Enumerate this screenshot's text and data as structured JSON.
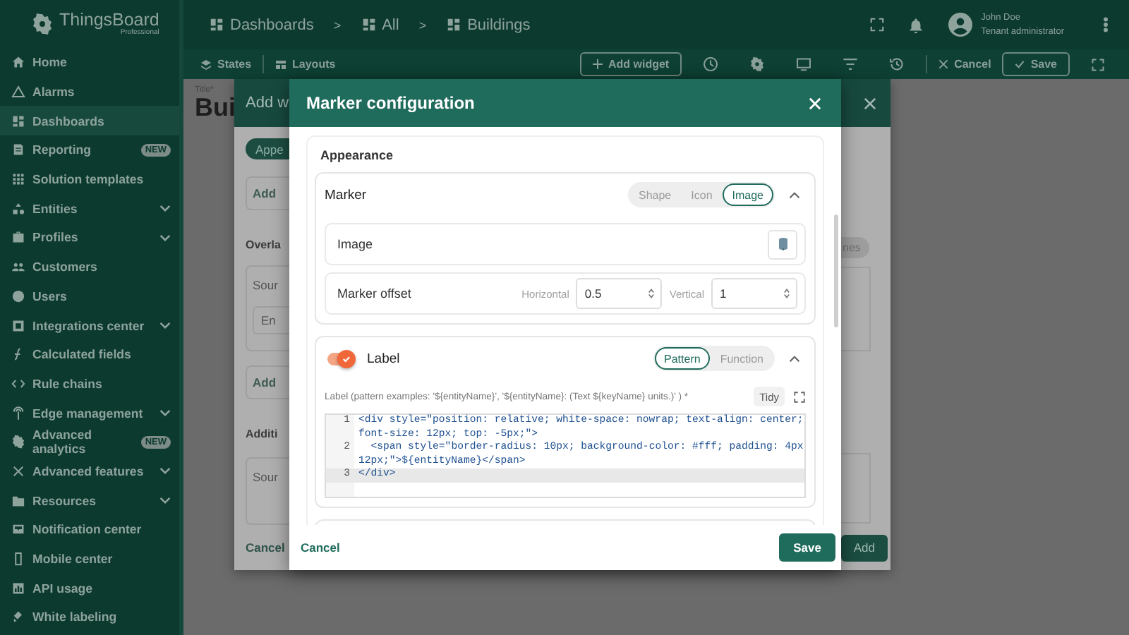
{
  "header": {
    "logo": {
      "name": "ThingsBoard",
      "edition": "Professional"
    },
    "breadcrumbs": [
      {
        "label": "Dashboards"
      },
      {
        "label": "All",
        "separator": ">"
      },
      {
        "label": "Buildings",
        "separator": ">"
      }
    ],
    "user": {
      "name": "John Doe",
      "role": "Tenant administrator"
    }
  },
  "sidebar": {
    "items": [
      {
        "label": "Home",
        "selected": false,
        "expandable": false
      },
      {
        "label": "Alarms",
        "selected": false,
        "expandable": false
      },
      {
        "label": "Dashboards",
        "selected": true,
        "expandable": false
      },
      {
        "label": "Reporting",
        "selected": false,
        "expandable": false,
        "badge": "NEW"
      },
      {
        "label": "Solution templates",
        "selected": false,
        "expandable": false
      },
      {
        "label": "Entities",
        "selected": false,
        "expandable": true
      },
      {
        "label": "Profiles",
        "selected": false,
        "expandable": true
      },
      {
        "label": "Customers",
        "selected": false,
        "expandable": false
      },
      {
        "label": "Users",
        "selected": false,
        "expandable": false
      },
      {
        "label": "Integrations center",
        "selected": false,
        "expandable": true
      },
      {
        "label": "Calculated fields",
        "selected": false,
        "expandable": false
      },
      {
        "label": "Rule chains",
        "selected": false,
        "expandable": false
      },
      {
        "label": "Edge management",
        "selected": false,
        "expandable": true
      },
      {
        "label": "Advanced analytics",
        "selected": false,
        "expandable": false,
        "badge": "NEW"
      },
      {
        "label": "Advanced features",
        "selected": false,
        "expandable": true
      },
      {
        "label": "Resources",
        "selected": false,
        "expandable": true
      },
      {
        "label": "Notification center",
        "selected": false,
        "expandable": false
      },
      {
        "label": "Mobile center",
        "selected": false,
        "expandable": false
      },
      {
        "label": "API usage",
        "selected": false,
        "expandable": false
      },
      {
        "label": "White labeling",
        "selected": false,
        "expandable": false
      }
    ]
  },
  "toolbar": {
    "states": "States",
    "layouts": "Layouts",
    "add_widget": "Add widget",
    "cancel": "Cancel",
    "save": "Save"
  },
  "content": {
    "title_label": "Title*",
    "title_value": "Bui"
  },
  "back_dialog": {
    "title": "Add w",
    "tab": "Appe",
    "add_1": "Add",
    "section_1": "Overla",
    "source_1": "Sour",
    "entity": "En",
    "add_2": "Add",
    "section_2": "Additi",
    "source_2": "Sour",
    "chip": "nes",
    "cancel": "Cancel",
    "add": "Add"
  },
  "dialog": {
    "title": "Marker configuration",
    "section": "Appearance",
    "marker": {
      "title": "Marker",
      "expanded": true,
      "types": [
        {
          "label": "Shape",
          "selected": false
        },
        {
          "label": "Icon",
          "selected": false
        },
        {
          "label": "Image",
          "selected": true
        }
      ],
      "image_label": "Image",
      "offset_label": "Marker offset",
      "horizontal": {
        "label": "Horizontal",
        "value": "0.5"
      },
      "vertical": {
        "label": "Vertical",
        "value": "1"
      }
    },
    "label": {
      "enabled": true,
      "title": "Label",
      "expanded": true,
      "modes": [
        {
          "label": "Pattern",
          "selected": true
        },
        {
          "label": "Function",
          "selected": false
        }
      ],
      "hint": "Label (pattern examples: '${entityName}', '${entityName}: (Text ${keyName} units.)' ) *",
      "tidy": "Tidy",
      "code_lines": [
        {
          "number": "1",
          "text": "<div style=\"position: relative; white-space: nowrap; text-align: center; font-size: 12px; top: -5px;\">",
          "active": false
        },
        {
          "number": "2",
          "text": "  <span style=\"border-radius: 10px; background-color: #fff; padding: 4px 12px;\">${entityName}</span>",
          "active": false
        },
        {
          "number": "3",
          "text": "</div>",
          "active": true
        }
      ]
    },
    "cancel": "Cancel",
    "save": "Save"
  }
}
